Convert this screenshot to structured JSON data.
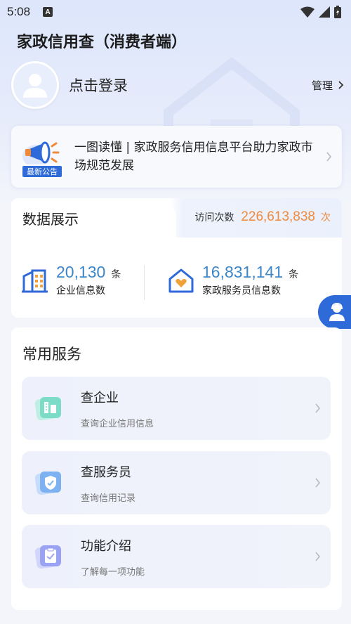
{
  "status_bar": {
    "time": "5:08",
    "app_icon_letter": "A"
  },
  "header": {
    "title": "家政信用查（消费者端）"
  },
  "login": {
    "label": "点击登录",
    "manage_label": "管理"
  },
  "notice": {
    "badge": "最新公告",
    "text": "一图读懂 | 家政服务信用信息平台助力家政市场规范发展"
  },
  "data_display": {
    "title": "数据展示",
    "visits_label": "访问次数",
    "visits_value": "226,613,838",
    "visits_unit": "次",
    "stats": [
      {
        "value": "20,130",
        "unit": "条",
        "label": "企业信息数",
        "icon": "building-icon"
      },
      {
        "value": "16,831,141",
        "unit": "条",
        "label": "家政服务员信息数",
        "icon": "house-heart-icon"
      }
    ]
  },
  "services": {
    "title": "常用服务",
    "items": [
      {
        "name": "查企业",
        "desc": "查询企业信用信息",
        "icon": "enterprise-icon"
      },
      {
        "name": "查服务员",
        "desc": "查询信用记录",
        "icon": "shield-check-icon"
      },
      {
        "name": "功能介绍",
        "desc": "了解每一项功能",
        "icon": "clipboard-icon"
      }
    ]
  },
  "colors": {
    "accent_blue": "#2f6bd8",
    "stat_blue": "#3b86c9",
    "visits_orange": "#f0893b",
    "background": "#f3f5fb"
  }
}
